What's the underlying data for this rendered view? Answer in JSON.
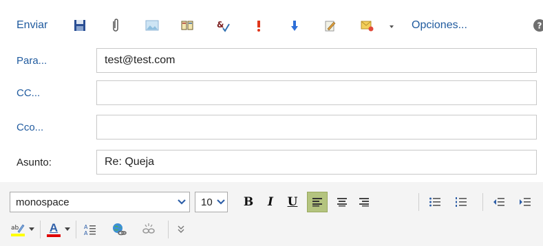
{
  "toolbar": {
    "send_label": "Enviar",
    "options_label": "Opciones...",
    "icons": [
      "save-icon",
      "attach-icon",
      "insert-image-icon",
      "address-book-icon",
      "spell-check-icon",
      "high-importance-icon",
      "low-importance-icon",
      "signature-icon",
      "flag-icon",
      "help-icon"
    ]
  },
  "fields": {
    "to_label": "Para...",
    "to_value": "test@test.com",
    "cc_label": "CC...",
    "cc_value": "",
    "bcc_label": "Cco...",
    "bcc_value": "",
    "subject_label": "Asunto:",
    "subject_value": "Re: Queja"
  },
  "formatting": {
    "font_family": "monospace",
    "font_size": "10",
    "bold_label": "B",
    "italic_label": "I",
    "underline_label": "U",
    "font_color_label": "A",
    "active_alignment": "left"
  },
  "colors": {
    "link": "#1f5a9e",
    "active_button": "#b4c47f",
    "highlight": "#ffff00",
    "font_color": "#e00000"
  }
}
